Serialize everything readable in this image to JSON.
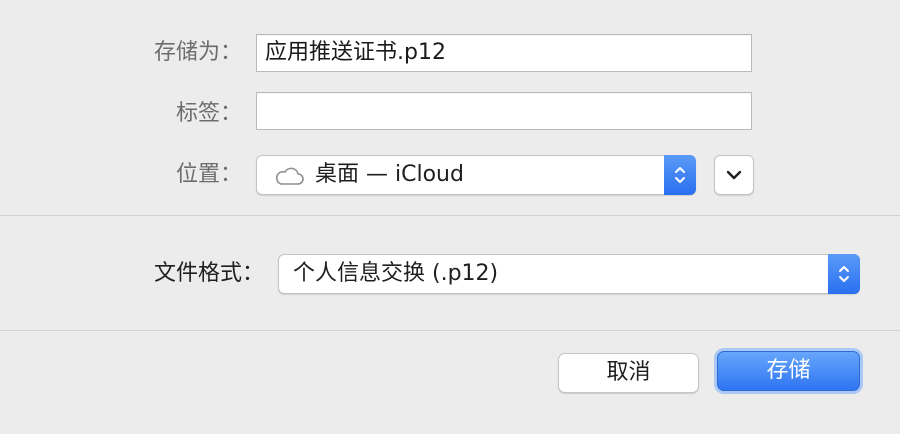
{
  "form": {
    "save_as": {
      "label": "存储为：",
      "value": "应用推送证书.p12"
    },
    "tags": {
      "label": "标签：",
      "value": ""
    },
    "location": {
      "label": "位置：",
      "selected": "桌面 — iCloud",
      "icon": "cloud-icon"
    },
    "expand_icon": "chevron-down-icon"
  },
  "format": {
    "label": "文件格式：",
    "selected": "个人信息交换 (.p12)"
  },
  "buttons": {
    "cancel": "取消",
    "save": "存储"
  },
  "colors": {
    "accent": "#2f74f2",
    "background": "#ececec"
  }
}
